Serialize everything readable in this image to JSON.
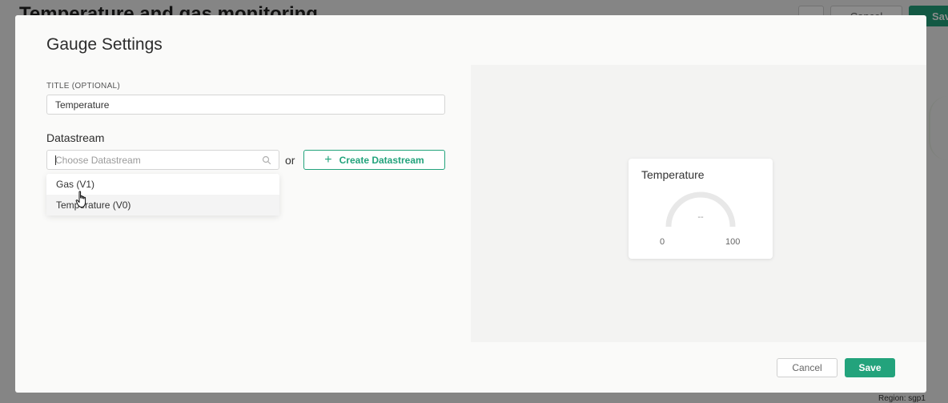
{
  "background": {
    "title": "Temperature and gas monitoring",
    "more_label": "...",
    "cancel_label": "Cancel",
    "save_label": "Save",
    "region_text": "Region: sgp1"
  },
  "modal": {
    "title": "Gauge Settings",
    "title_field": {
      "label": "TITLE (OPTIONAL)",
      "value": "Temperature"
    },
    "datastream": {
      "label": "Datastream",
      "placeholder": "Choose Datastream",
      "or_text": "or",
      "create_label": "Create Datastream",
      "options": [
        "Gas (V1)",
        "Temperature (V0)"
      ],
      "hovered_option": "Temperature (V0)"
    },
    "preview": {
      "title": "Temperature",
      "value": "--",
      "min": "0",
      "max": "100"
    },
    "footer": {
      "cancel_label": "Cancel",
      "save_label": "Save"
    }
  },
  "colors": {
    "accent": "#23a37c",
    "gauge_track": "#e8e8e8"
  },
  "icons": [
    "search-icon",
    "plus-icon",
    "hand-pointer-icon"
  ]
}
